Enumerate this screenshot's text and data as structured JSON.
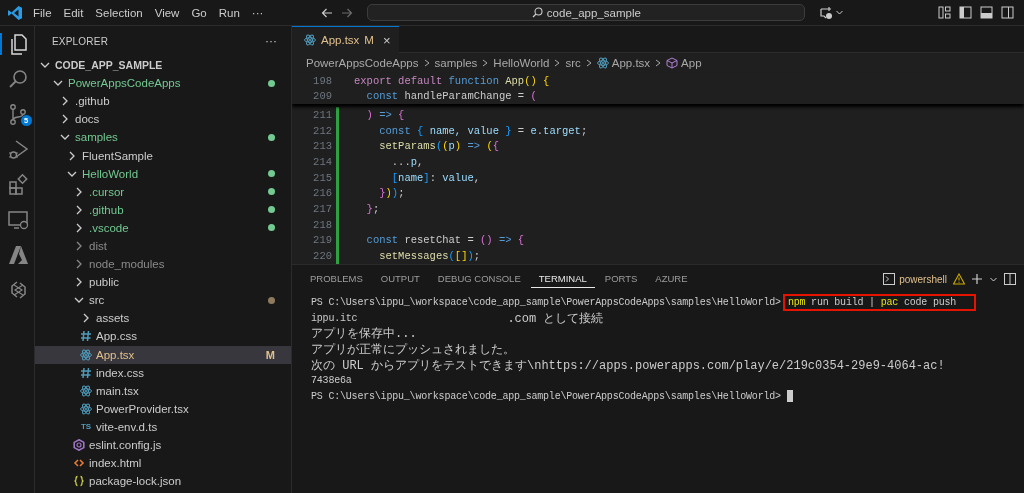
{
  "title_bar": {
    "menu": [
      "File",
      "Edit",
      "Selection",
      "View",
      "Go",
      "Run",
      "···"
    ],
    "search": "code_app_sample"
  },
  "activity_bar": {
    "items": [
      {
        "kind": "explorer",
        "selected": true
      },
      {
        "kind": "search",
        "selected": false
      },
      {
        "kind": "source-control",
        "selected": false,
        "badge": "5"
      },
      {
        "kind": "run-debug",
        "selected": false
      },
      {
        "kind": "extensions",
        "selected": false
      },
      {
        "kind": "remote",
        "selected": false
      },
      {
        "kind": "azure",
        "selected": false
      },
      {
        "kind": "power-platform",
        "selected": false
      }
    ]
  },
  "explorer": {
    "title": "EXPLORER",
    "more": "···",
    "root": {
      "name": "CODE_APP_SAMPLE",
      "expanded": true,
      "children": [
        {
          "kind": "folder",
          "name": "PowerAppsCodeApps",
          "expanded": true,
          "untracked": true,
          "ignored": false,
          "modified": false,
          "contains_changes": false,
          "selected": false,
          "children": [
            {
              "kind": "folder",
              "name": ".github",
              "expanded": false,
              "untracked": false,
              "ignored": false,
              "modified": false,
              "contains_changes": false,
              "selected": false
            },
            {
              "kind": "folder",
              "name": "docs",
              "expanded": false,
              "untracked": false,
              "ignored": false,
              "modified": false,
              "contains_changes": false,
              "selected": false
            },
            {
              "kind": "folder",
              "name": "samples",
              "expanded": true,
              "untracked": true,
              "ignored": false,
              "modified": false,
              "contains_changes": false,
              "selected": false,
              "children": [
                {
                  "kind": "folder",
                  "name": "FluentSample",
                  "expanded": false,
                  "untracked": false,
                  "ignored": false,
                  "modified": false,
                  "contains_changes": false,
                  "selected": false
                },
                {
                  "kind": "folder",
                  "name": "HelloWorld",
                  "expanded": true,
                  "untracked": true,
                  "ignored": false,
                  "modified": false,
                  "contains_changes": false,
                  "selected": false,
                  "children": [
                    {
                      "kind": "folder",
                      "name": ".cursor",
                      "expanded": false,
                      "untracked": true,
                      "ignored": false,
                      "modified": false,
                      "contains_changes": false,
                      "selected": false
                    },
                    {
                      "kind": "folder",
                      "name": ".github",
                      "expanded": false,
                      "untracked": true,
                      "ignored": false,
                      "modified": false,
                      "contains_changes": false,
                      "selected": false
                    },
                    {
                      "kind": "folder",
                      "name": ".vscode",
                      "expanded": false,
                      "untracked": true,
                      "ignored": false,
                      "modified": false,
                      "contains_changes": false,
                      "selected": false
                    },
                    {
                      "kind": "folder",
                      "name": "dist",
                      "expanded": false,
                      "untracked": false,
                      "ignored": true,
                      "modified": false,
                      "contains_changes": false,
                      "selected": false
                    },
                    {
                      "kind": "folder",
                      "name": "node_modules",
                      "expanded": false,
                      "untracked": false,
                      "ignored": true,
                      "modified": false,
                      "contains_changes": false,
                      "selected": false
                    },
                    {
                      "kind": "folder",
                      "name": "public",
                      "expanded": false,
                      "untracked": false,
                      "ignored": false,
                      "modified": false,
                      "contains_changes": false,
                      "selected": false
                    },
                    {
                      "kind": "folder",
                      "name": "src",
                      "expanded": true,
                      "untracked": false,
                      "ignored": false,
                      "modified": false,
                      "contains_changes": true,
                      "selected": false,
                      "children": [
                        {
                          "kind": "folder",
                          "name": "assets",
                          "expanded": false,
                          "untracked": false,
                          "ignored": false,
                          "modified": false,
                          "contains_changes": false,
                          "selected": false
                        },
                        {
                          "kind": "css-file",
                          "name": "App.css",
                          "untracked": false,
                          "ignored": false,
                          "modified": false,
                          "contains_changes": false,
                          "selected": false
                        },
                        {
                          "kind": "react-file",
                          "name": "App.tsx",
                          "untracked": false,
                          "ignored": false,
                          "modified": true,
                          "contains_changes": false,
                          "badge": "M",
                          "selected": true
                        },
                        {
                          "kind": "css-file",
                          "name": "index.css",
                          "untracked": false,
                          "ignored": false,
                          "modified": false,
                          "contains_changes": false,
                          "selected": false
                        },
                        {
                          "kind": "react-file",
                          "name": "main.tsx",
                          "untracked": false,
                          "ignored": false,
                          "modified": false,
                          "contains_changes": false,
                          "selected": false
                        },
                        {
                          "kind": "react-file",
                          "name": "PowerProvider.tsx",
                          "untracked": false,
                          "ignored": false,
                          "modified": false,
                          "contains_changes": false,
                          "selected": false
                        },
                        {
                          "kind": "ts-file",
                          "name": "vite-env.d.ts",
                          "icon_label": "TS",
                          "untracked": false,
                          "ignored": false,
                          "modified": false,
                          "contains_changes": false,
                          "selected": false
                        }
                      ]
                    },
                    {
                      "kind": "eslint-file",
                      "name": "eslint.config.js",
                      "untracked": false,
                      "ignored": false,
                      "modified": false,
                      "contains_changes": false,
                      "selected": false
                    },
                    {
                      "kind": "html-file",
                      "name": "index.html",
                      "untracked": false,
                      "ignored": false,
                      "modified": false,
                      "contains_changes": false,
                      "selected": false
                    },
                    {
                      "kind": "json-file",
                      "name": "package-lock.json",
                      "untracked": false,
                      "ignored": false,
                      "modified": false,
                      "contains_changes": false,
                      "selected": false
                    }
                  ]
                }
              ]
            }
          ]
        }
      ]
    }
  },
  "editor": {
    "tabs": [
      {
        "kind": "react-file",
        "label": "App.tsx",
        "badge": "M",
        "close": "×",
        "selected": true
      }
    ],
    "breadcrumb": [
      {
        "kind": "folder",
        "text": "PowerAppsCodeApps"
      },
      {
        "kind": "folder",
        "text": "samples"
      },
      {
        "kind": "folder",
        "text": "HelloWorld"
      },
      {
        "kind": "folder",
        "text": "src"
      },
      {
        "kind": "react-file",
        "text": "App.tsx"
      },
      {
        "kind": "symbol",
        "text": "App"
      }
    ],
    "sticky_lines": [
      {
        "number": "198",
        "tokens": [
          {
            "text": "export",
            "kind": "ctl"
          },
          {
            "text": " default",
            "kind": "ctl"
          },
          {
            "text": " function",
            "kind": "kw"
          },
          {
            "text": " App",
            "kind": "fn"
          },
          {
            "text": "()",
            "kind": "b1"
          },
          {
            "text": " {",
            "kind": "b1"
          }
        ]
      },
      {
        "number": "209",
        "tokens": [
          {
            "text": "  const",
            "kind": "kw"
          },
          {
            "text": " handleParamChange = ",
            "kind": "plain"
          },
          {
            "text": "(",
            "kind": "b2"
          }
        ]
      }
    ],
    "lines": [
      {
        "number": "211",
        "changed": true,
        "tokens": [
          {
            "text": "  )",
            "kind": "b2"
          },
          {
            "text": " =>",
            "kind": "kw"
          },
          {
            "text": " {",
            "kind": "b2"
          }
        ]
      },
      {
        "number": "212",
        "changed": true,
        "tokens": [
          {
            "text": "    const",
            "kind": "kw"
          },
          {
            "text": " {",
            "kind": "b3"
          },
          {
            "text": " name, value ",
            "kind": "var"
          },
          {
            "text": "}",
            "kind": "b3"
          },
          {
            "text": " = ",
            "kind": "plain"
          },
          {
            "text": "e",
            "kind": "var"
          },
          {
            "text": ".",
            "kind": "plain"
          },
          {
            "text": "target",
            "kind": "var"
          },
          {
            "text": ";",
            "kind": "plain"
          }
        ]
      },
      {
        "number": "213",
        "changed": true,
        "tokens": [
          {
            "text": "    setParams",
            "kind": "fn"
          },
          {
            "text": "(",
            "kind": "b3"
          },
          {
            "text": "(",
            "kind": "b1"
          },
          {
            "text": "p",
            "kind": "var"
          },
          {
            "text": ")",
            "kind": "b1"
          },
          {
            "text": " =>",
            "kind": "kw"
          },
          {
            "text": " (",
            "kind": "b1"
          },
          {
            "text": "{",
            "kind": "b2"
          }
        ]
      },
      {
        "number": "214",
        "changed": true,
        "tokens": [
          {
            "text": "      ...",
            "kind": "plain"
          },
          {
            "text": "p",
            "kind": "var"
          },
          {
            "text": ",",
            "kind": "plain"
          }
        ]
      },
      {
        "number": "215",
        "changed": true,
        "tokens": [
          {
            "text": "      [",
            "kind": "b3"
          },
          {
            "text": "name",
            "kind": "var"
          },
          {
            "text": "]",
            "kind": "b3"
          },
          {
            "text": ": ",
            "kind": "plain"
          },
          {
            "text": "value",
            "kind": "var"
          },
          {
            "text": ",",
            "kind": "plain"
          }
        ]
      },
      {
        "number": "216",
        "changed": true,
        "tokens": [
          {
            "text": "    }",
            "kind": "b2"
          },
          {
            "text": ")",
            "kind": "b1"
          },
          {
            "text": ")",
            "kind": "b3"
          },
          {
            "text": ";",
            "kind": "plain"
          }
        ]
      },
      {
        "number": "217",
        "changed": true,
        "tokens": [
          {
            "text": "  }",
            "kind": "b2"
          },
          {
            "text": ";",
            "kind": "plain"
          }
        ]
      },
      {
        "number": "218",
        "changed": true
      },
      {
        "number": "219",
        "changed": true,
        "tokens": [
          {
            "text": "  const",
            "kind": "kw"
          },
          {
            "text": " resetChat = ",
            "kind": "plain"
          },
          {
            "text": "()",
            "kind": "b2"
          },
          {
            "text": " =>",
            "kind": "kw"
          },
          {
            "text": " {",
            "kind": "b2"
          }
        ]
      },
      {
        "number": "220",
        "changed": true,
        "tokens": [
          {
            "text": "    setMessages",
            "kind": "fn"
          },
          {
            "text": "(",
            "kind": "b3"
          },
          {
            "text": "[]",
            "kind": "b1"
          },
          {
            "text": ")",
            "kind": "b3"
          },
          {
            "text": ";",
            "kind": "plain"
          }
        ]
      }
    ]
  },
  "panel": {
    "tabs": [
      {
        "label": "PROBLEMS",
        "selected": false
      },
      {
        "label": "OUTPUT",
        "selected": false
      },
      {
        "label": "DEBUG CONSOLE",
        "selected": false
      },
      {
        "label": "TERMINAL",
        "selected": true
      },
      {
        "label": "PORTS",
        "selected": false
      },
      {
        "label": "AZURE",
        "selected": false
      }
    ],
    "terminal_name": "powershell",
    "terminal": [
      {
        "prompt": "PS C:\\Users\\ippu_\\workspace\\code_app_sample\\PowerAppsCodeApps\\samples\\HelloWorld>",
        "highlighted": true,
        "command": [
          {
            "text": "npm",
            "kind": "cmd"
          },
          {
            "text": " run build | ",
            "kind": "plain"
          },
          {
            "text": "pac",
            "kind": "cmd"
          },
          {
            "text": " code push",
            "kind": "plain"
          }
        ]
      },
      {
        "tokens": [
          {
            "text": "ippu.itc",
            "kind": "plain"
          },
          {
            "kind": "redacted"
          },
          {
            "text": ".com として接続",
            "kind": "plain"
          }
        ]
      },
      {
        "tokens": [
          {
            "text": "アプリを保存中...",
            "kind": "plain"
          }
        ]
      },
      {
        "tokens": [
          {
            "text": "アプリが正常にプッシュされました。",
            "kind": "plain"
          }
        ]
      },
      {
        "tokens": [
          {
            "text": "次の URL からアプリをテストできます\\nhttps://apps.powerapps.com/play/e/219c0354-29e9-4064-ac!",
            "kind": "plain"
          }
        ]
      },
      {
        "tokens": [
          {
            "text": "7438e6a",
            "kind": "plain"
          }
        ]
      },
      {
        "prompt": "PS C:\\Users\\ippu_\\workspace\\code_app_sample\\PowerAppsCodeApps\\samples\\HelloWorld>",
        "cursor": true
      }
    ]
  }
}
